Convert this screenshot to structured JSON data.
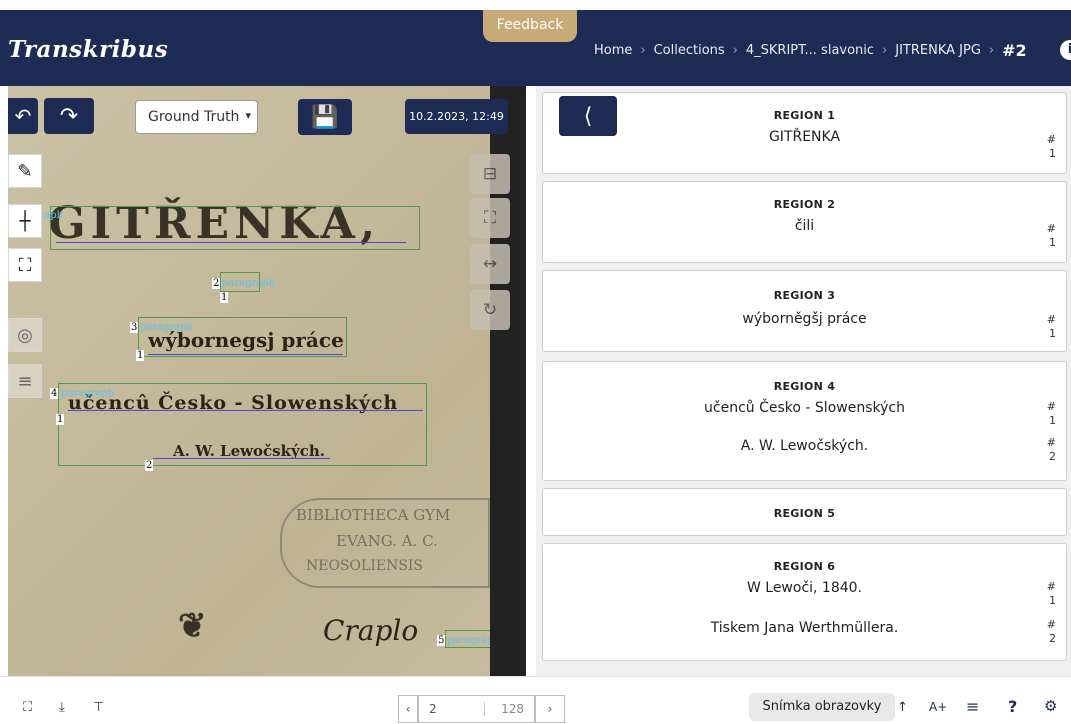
{
  "header": {
    "logo": "Transkribus",
    "feedback_label": "Feedback",
    "breadcrumb": [
      "Home",
      "Collections",
      "4_SKRIPT... slavonic",
      "JITRENKA JPG"
    ],
    "current_page": "#2",
    "info_icon": "i"
  },
  "toolbar": {
    "ground_truth": "Ground Truth",
    "timestamp": "10.2.2023, 12:49"
  },
  "canvas": {
    "scan_lines": [
      {
        "text": "GITŘENKA,"
      },
      {
        "text": "wýbornegsj práce"
      },
      {
        "text": "učencû Česko - Slowenských"
      },
      {
        "text": "A. W. Lewočských."
      }
    ],
    "stamp_lines": [
      "BIBLIOTHECA GYM",
      "EVANG. A. C.",
      "NEOSOLIENSIS"
    ],
    "signature_text": "Craplo",
    "region_labels": [
      {
        "num": "1",
        "tag": "paragraph",
        "line": "1"
      },
      {
        "num": "2",
        "tag": "paragraph",
        "line": "1"
      },
      {
        "num": "3",
        "tag": "paragraph",
        "line": "1"
      },
      {
        "num": "4",
        "tag": "paragraph",
        "line": "1",
        "line2": "2"
      },
      {
        "num": "5",
        "tag": "paragraph"
      }
    ]
  },
  "regions": [
    {
      "title": "REGION 1",
      "lines": [
        {
          "text": "GITŘENKA",
          "hash": "#",
          "n": "1"
        }
      ]
    },
    {
      "title": "REGION 2",
      "lines": [
        {
          "text": "čili",
          "hash": "#",
          "n": "1"
        }
      ]
    },
    {
      "title": "REGION 3",
      "lines": [
        {
          "text": "wýborněgšj práce",
          "hash": "#",
          "n": "1"
        }
      ]
    },
    {
      "title": "REGION 4",
      "lines": [
        {
          "text": "učenců Česko - Slowenských",
          "hash": "#",
          "n": "1"
        },
        {
          "text": "A. W. Lewočských.",
          "hash": "#",
          "n": "2"
        }
      ]
    },
    {
      "title": "REGION 5",
      "lines": []
    },
    {
      "title": "REGION 6",
      "lines": [
        {
          "text": "W Lewoči, 1840.",
          "hash": "#",
          "n": "1"
        },
        {
          "text": "Tiskem Jana Werthmüllera.",
          "hash": "#",
          "n": "2"
        }
      ]
    }
  ],
  "footer": {
    "page_value": "2",
    "total_pages": "128",
    "tooltip": "Snímka obrazovky",
    "font_label": "A+",
    "help_label": "?"
  },
  "colors": {
    "navy": "#1d2b55",
    "accent": "#c7ab76",
    "region_box": "#4f9a4f",
    "label_blue": "#5bc3f0"
  }
}
